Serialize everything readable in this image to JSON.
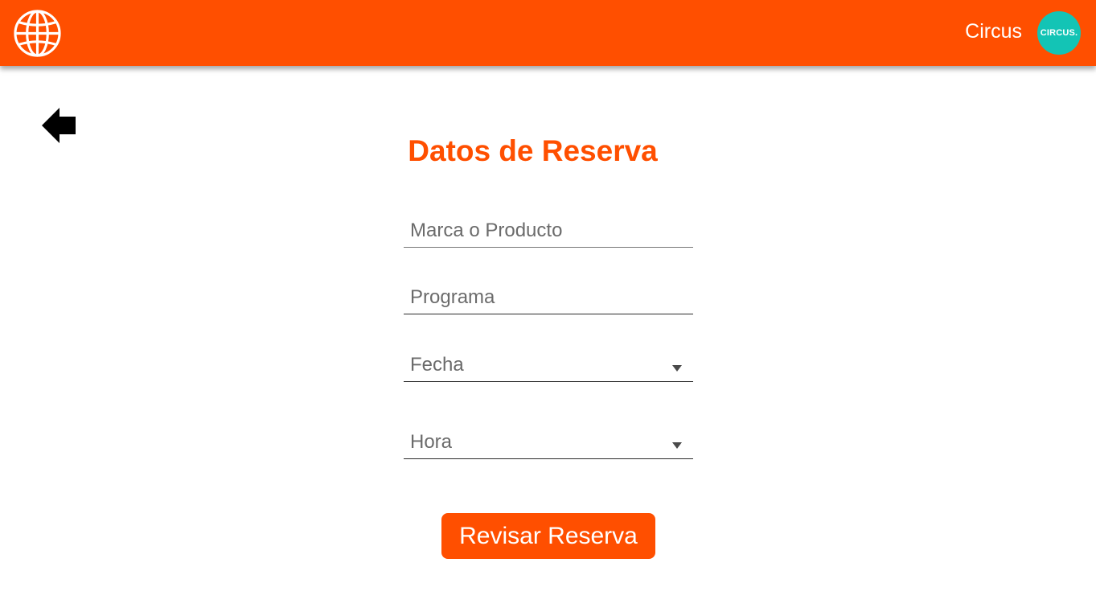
{
  "header": {
    "logo_icon": "globe-icon",
    "account_name": "Circus",
    "avatar_text": "CIRCUS.",
    "background_color": "#ff4f00",
    "avatar_color": "#13c4b5"
  },
  "nav": {
    "back_icon": "arrow-left-icon"
  },
  "main": {
    "title": "Datos de Reserva",
    "fields": {
      "marca": {
        "placeholder": "Marca o Producto",
        "value": ""
      },
      "programa": {
        "placeholder": "Programa",
        "value": ""
      },
      "fecha": {
        "placeholder": "Fecha",
        "selected": "",
        "icon": "chevron-down-icon"
      },
      "hora": {
        "placeholder": "Hora",
        "selected": "",
        "icon": "chevron-down-icon"
      }
    },
    "submit_label": "Revisar Reserva",
    "accent_color": "#ff4f00"
  }
}
